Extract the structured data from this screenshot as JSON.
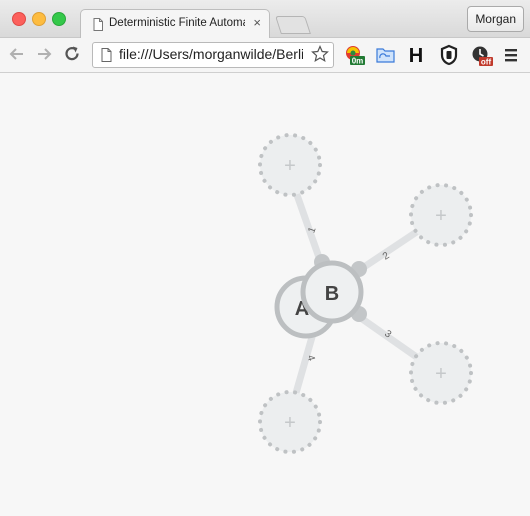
{
  "window": {
    "tab_title": "Deterministic Finite Automata",
    "tab_close": "×",
    "profile_name": "Morgan"
  },
  "toolbar": {
    "url": "file:///Users/morganwilde/Berlin/dfa/index.html",
    "extensions": [
      {
        "icon": "timer-extension-icon",
        "badge": "0m"
      },
      {
        "icon": "folder-extension-icon",
        "badge": ""
      },
      {
        "icon": "h-extension-icon",
        "label": "H"
      },
      {
        "icon": "shield-extension-icon",
        "badge": ""
      },
      {
        "icon": "clock-extension-icon",
        "badge": "off"
      },
      {
        "icon": "menu-icon",
        "badge": ""
      }
    ]
  },
  "automaton": {
    "states": [
      {
        "id": "A",
        "label": "A"
      },
      {
        "id": "B",
        "label": "B"
      }
    ],
    "placeholders": [
      {
        "id": "p1",
        "symbol": "+"
      },
      {
        "id": "p2",
        "symbol": "+"
      },
      {
        "id": "p3",
        "symbol": "+"
      },
      {
        "id": "p4",
        "symbol": "+"
      }
    ],
    "transitions": [
      {
        "from": "B",
        "to": "p1",
        "label": "1"
      },
      {
        "from": "B",
        "to": "p2",
        "label": "2"
      },
      {
        "from": "B",
        "to": "p3",
        "label": "3"
      },
      {
        "from": "B",
        "to": "p4",
        "label": "4"
      }
    ]
  },
  "colors": {
    "state_fill": "#eef0f1",
    "state_stroke": "#bcbfc1",
    "edge": "#dfe1e3",
    "placeholder_dot": "#bfc2c4",
    "placeholder_fill": "#eceeef"
  }
}
